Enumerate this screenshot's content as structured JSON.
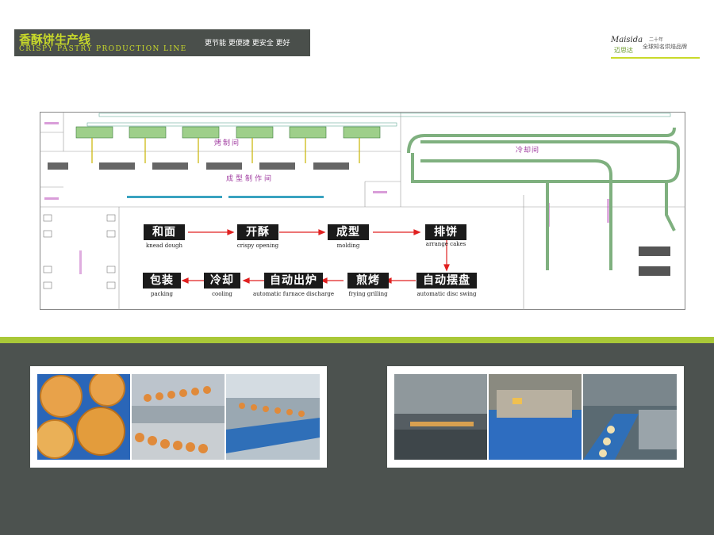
{
  "header": {
    "title_cn": "香酥饼生产线",
    "title_en": "CRISPY PASTRY PRODUCTION LINE",
    "slogan": "更节能  更便捷  更安全  更好"
  },
  "logo": {
    "brand_en": "Maisida",
    "brand_cn": "迈思达",
    "tagline_top": "二十年",
    "tagline": "全球知名烘焙品牌"
  },
  "plan": {
    "rooms": {
      "baking": "烤制间",
      "forming": "成型制作间",
      "cooling": "冷却间"
    }
  },
  "flow": [
    {
      "cn": "和面",
      "en": "knead dough"
    },
    {
      "cn": "开酥",
      "en": "crispy opening"
    },
    {
      "cn": "成型",
      "en": "molding"
    },
    {
      "cn": "排饼",
      "en": "arrange cakes"
    },
    {
      "cn": "自动摆盘",
      "en": "automatic disc swing"
    },
    {
      "cn": "煎烤",
      "en": "frying grilling"
    },
    {
      "cn": "自动出炉",
      "en": "automatic furnace discharge"
    },
    {
      "cn": "冷却",
      "en": "cooling"
    },
    {
      "cn": "包装",
      "en": "packing"
    }
  ],
  "colors": {
    "accent_green": "#c9da2a",
    "band_gray": "#4c524f",
    "line_green": "#a9c838",
    "arrow_red": "#e02020",
    "box_black": "#1b1b1b"
  }
}
